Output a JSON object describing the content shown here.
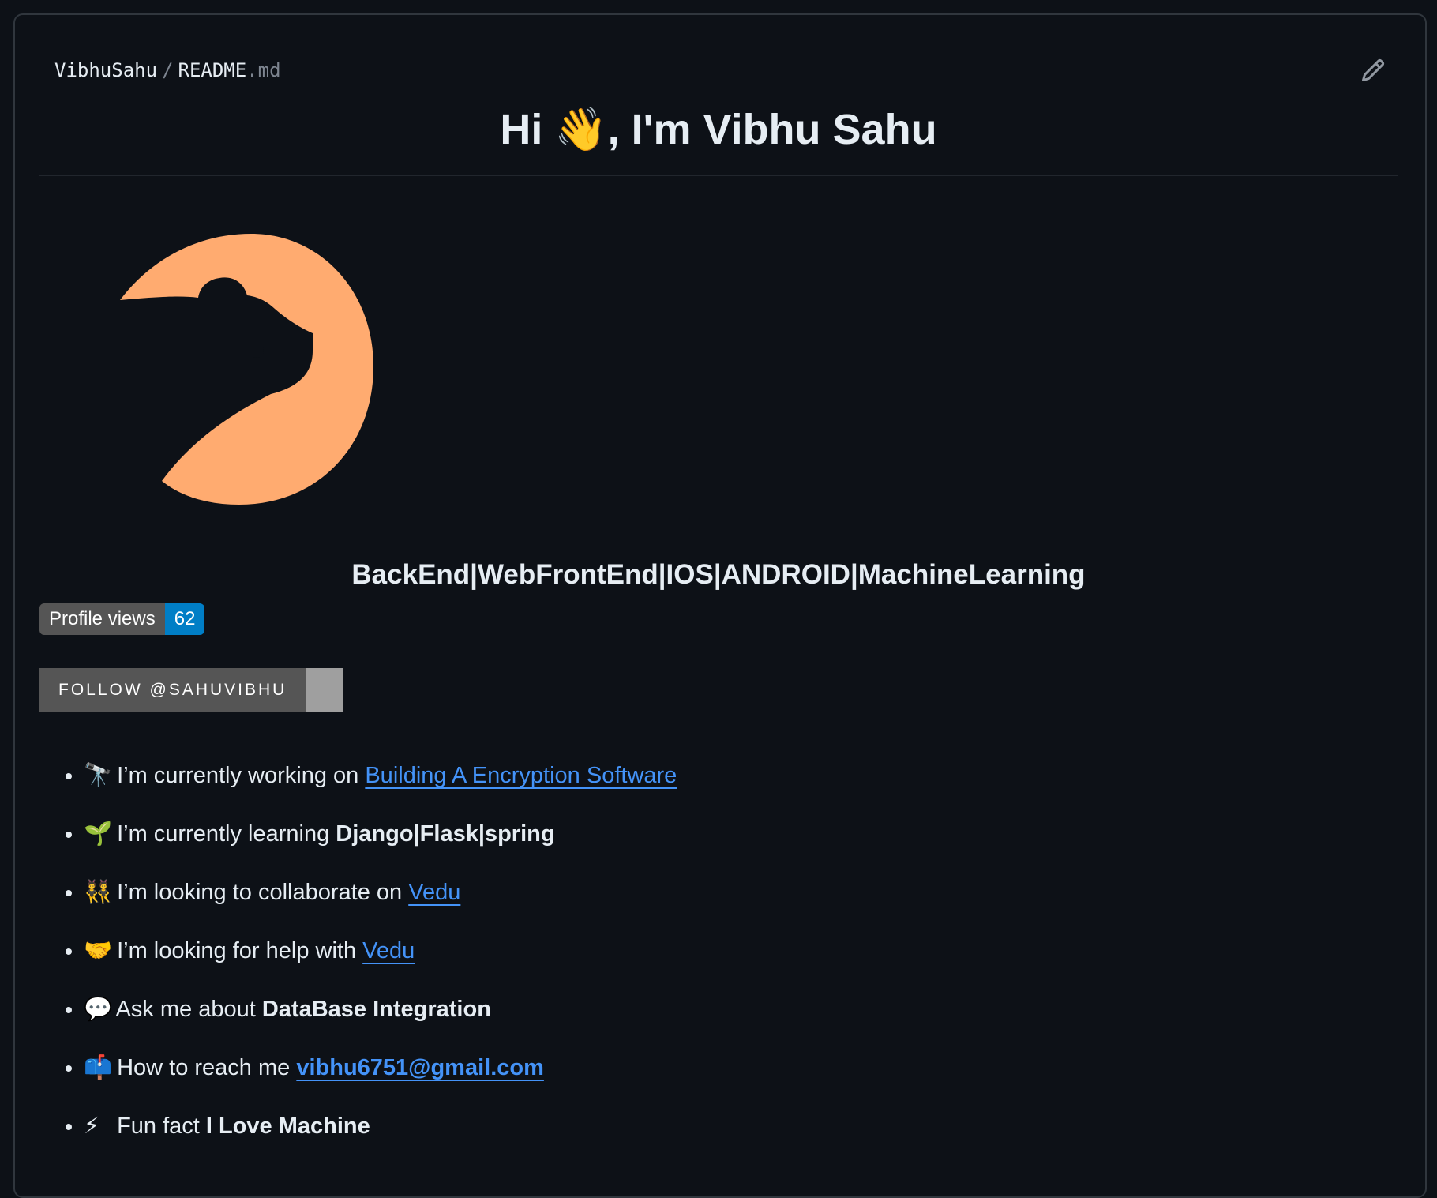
{
  "breadcrumb": {
    "owner": "VibhuSahu",
    "separator": "/",
    "file_name": "README",
    "file_ext": ".md"
  },
  "header": {
    "edit_icon": "pencil-icon"
  },
  "title": "Hi 👋, I'm Vibhu Sahu",
  "logo": {
    "icon": "bear-moon-logo",
    "color": "#ffab70"
  },
  "tagline": "BackEnd|WebFrontEnd|IOS|ANDROID|MachineLearning",
  "profile_views": {
    "label": "Profile views",
    "count": "62"
  },
  "follow_badge": {
    "label": "FOLLOW @SAHUVIBHU"
  },
  "facts": [
    {
      "emoji": "🔭",
      "text": "I’m currently working on ",
      "link": "Building A Encryption Software"
    },
    {
      "emoji": "🌱",
      "text": "I’m currently learning ",
      "bold": "Django|Flask|spring"
    },
    {
      "emoji": "👯",
      "text": "I’m looking to collaborate on ",
      "link": "Vedu"
    },
    {
      "emoji": "🤝",
      "text": "I’m looking for help with ",
      "link": "Vedu"
    },
    {
      "emoji": "💬",
      "text": "Ask me about ",
      "bold": "DataBase Integration"
    },
    {
      "emoji": "📫",
      "text": "How to reach me ",
      "link": "vibhu6751@gmail.com"
    },
    {
      "emoji": "⚡",
      "text": "Fun fact ",
      "bold": "I Love Machine"
    }
  ],
  "colors": {
    "background": "#0d1117",
    "link": "#4493f8",
    "views_count_bg": "#007ec6",
    "badge_label_bg": "#555555"
  }
}
